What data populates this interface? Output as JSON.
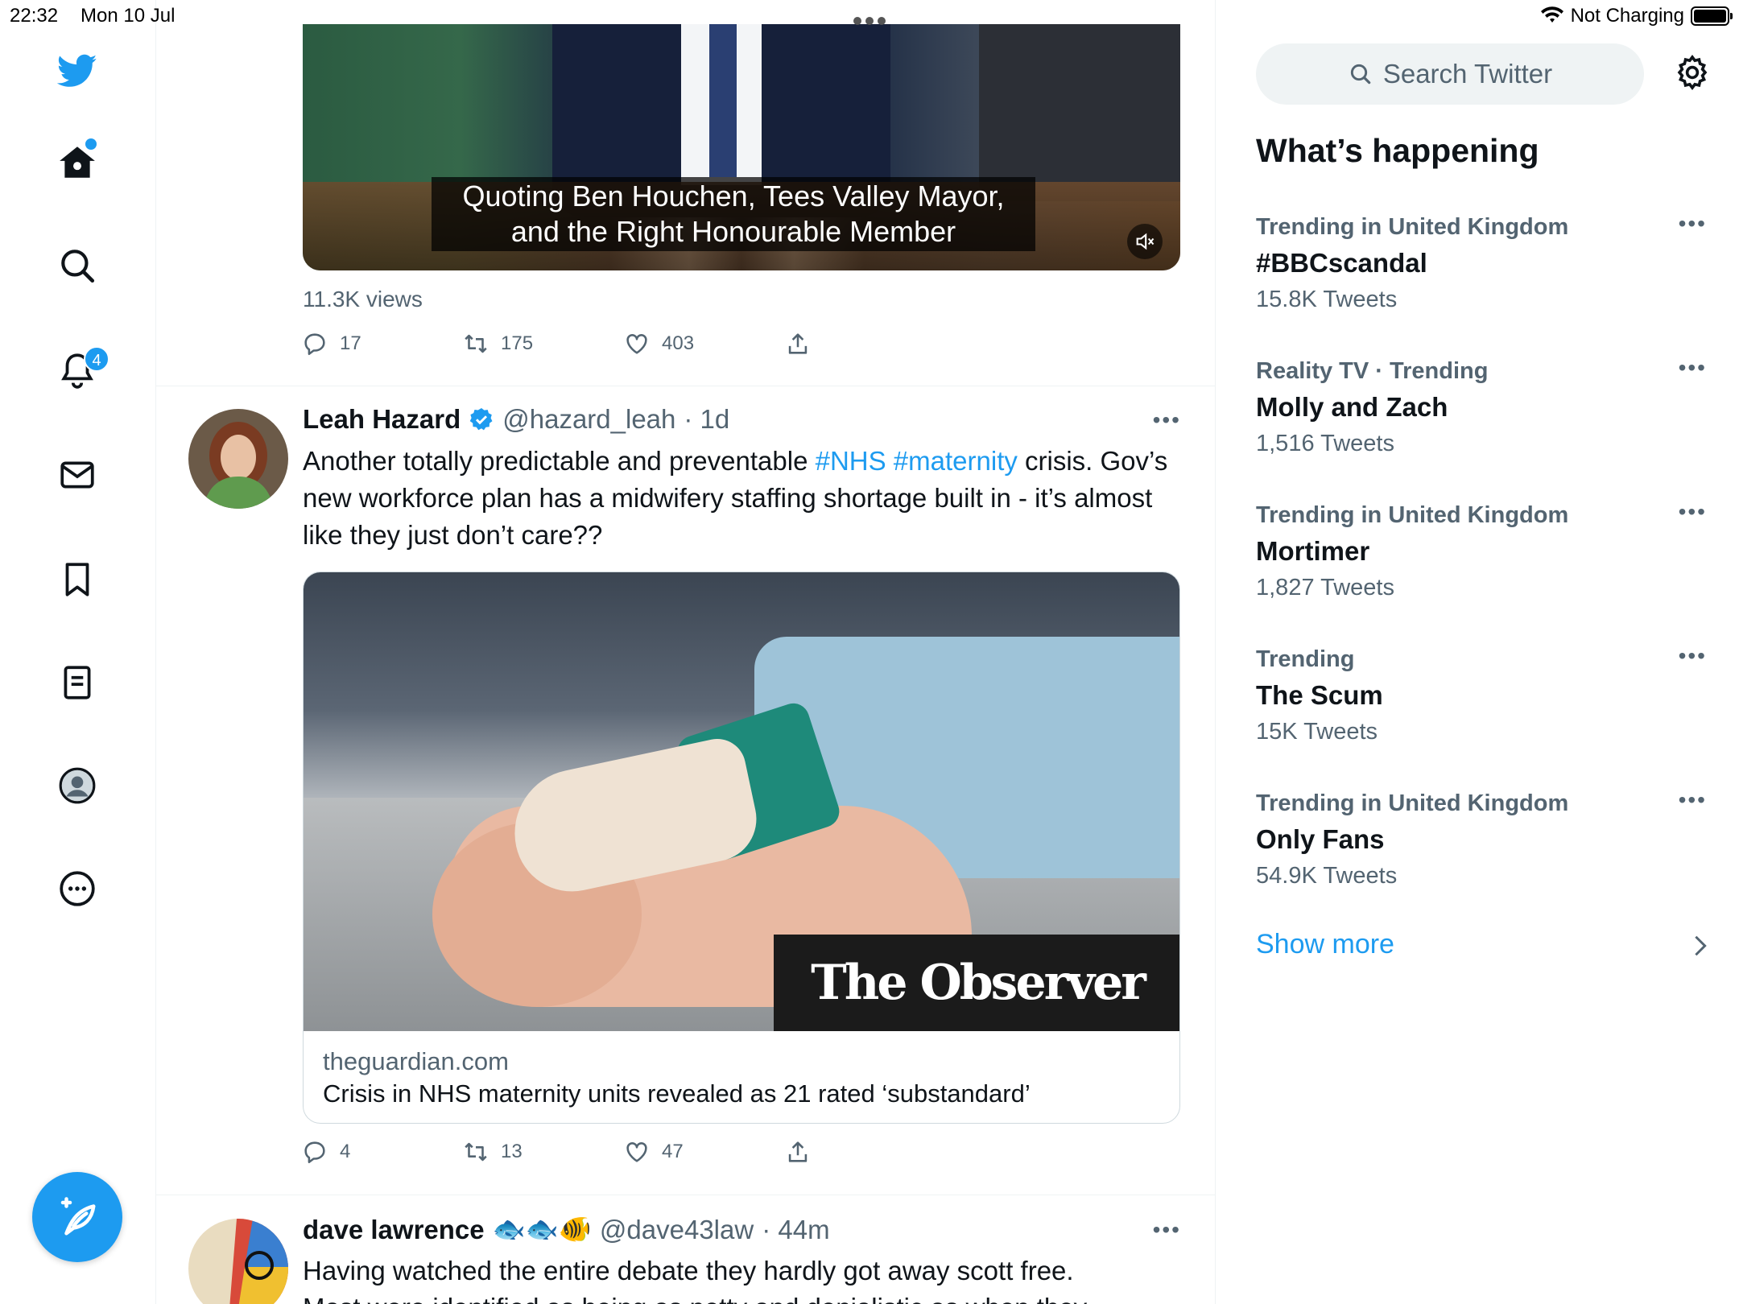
{
  "status_bar": {
    "time": "22:32",
    "date": "Mon 10 Jul",
    "charging": "Not Charging"
  },
  "nav": {
    "items": [
      "twitter-logo",
      "home",
      "explore",
      "notifications",
      "messages",
      "bookmarks",
      "lists",
      "profile",
      "more"
    ],
    "notifications_badge": "4"
  },
  "tweet1": {
    "video_caption_line1": "Quoting Ben Houchen, Tees Valley Mayor,",
    "video_caption_line2": "and the Right Honourable Member",
    "views": "11.3K views",
    "replies": "17",
    "retweets": "175",
    "likes": "403"
  },
  "tweet2": {
    "name": "Leah Hazard",
    "handle": "@hazard_leah",
    "time": "· 1d",
    "text_before": "Another totally predictable and preventable ",
    "hashtag1": "#NHS",
    "hashtag2": "#maternity",
    "text_after": " crisis. Gov’s new workforce plan has a midwifery staffing shortage built in - it’s almost like they just don’t care??",
    "card": {
      "overlay_brand": "The Observer",
      "domain": "theguardian.com",
      "title": "Crisis in NHS maternity units revealed as 21 rated ‘substandard’"
    },
    "replies": "4",
    "retweets": "13",
    "likes": "47"
  },
  "tweet3": {
    "name": "dave lawrence",
    "emoji": "🐟🐟🐠",
    "handle": "@dave43law",
    "time": "· 44m",
    "text_line1": "Having watched the entire debate they hardly got away scott free.",
    "text_line2": "Most were identified as being as petty and denialistic as when they"
  },
  "sidebar": {
    "search_placeholder": "Search Twitter",
    "title": "What’s happening",
    "trends": [
      {
        "context": "Trending in United Kingdom",
        "name": "#BBCscandal",
        "count": "15.8K Tweets"
      },
      {
        "context": "Reality TV · Trending",
        "name": "Molly and Zach",
        "count": "1,516 Tweets"
      },
      {
        "context": "Trending in United Kingdom",
        "name": "Mortimer",
        "count": "1,827 Tweets"
      },
      {
        "context": "Trending",
        "name": "The Scum",
        "count": "15K Tweets"
      },
      {
        "context": "Trending in United Kingdom",
        "name": "Only Fans",
        "count": "54.9K Tweets"
      }
    ],
    "show_more": "Show more"
  },
  "colors": {
    "accent": "#1d9bf0",
    "text_primary": "#0f1419",
    "text_secondary": "#536471"
  }
}
